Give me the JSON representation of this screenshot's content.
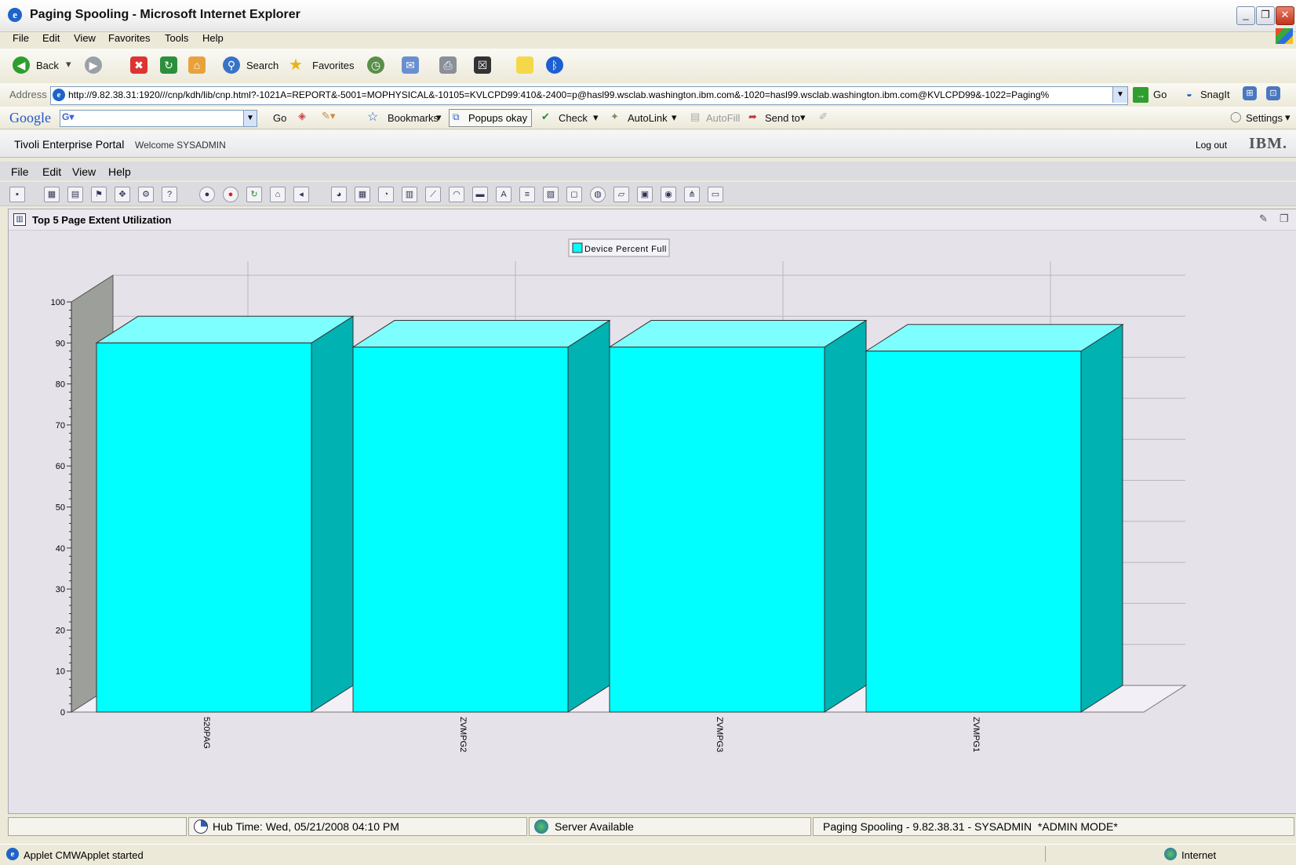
{
  "window": {
    "title": "Paging Spooling - Microsoft Internet Explorer"
  },
  "ie_menu": [
    "File",
    "Edit",
    "View",
    "Favorites",
    "Tools",
    "Help"
  ],
  "nav_toolbar": {
    "back": "Back",
    "search": "Search",
    "favorites": "Favorites"
  },
  "address_bar": {
    "label": "Address",
    "url": "http://9.82.38.31:1920///cnp/kdh/lib/cnp.html?-1021A=REPORT&-5001=MOPHYSICAL&-10105=KVLCPD99:410&-2400=p@hasl99.wsclab.washington.ibm.com&-1020=hasl99.wsclab.washington.ibm.com@KVLCPD99&-1022=Paging%",
    "go": "Go",
    "snagit": "SnagIt"
  },
  "google_bar": {
    "logo": "Google",
    "go": "Go",
    "bookmarks": "Bookmarks",
    "popups": "Popups okay",
    "check": "Check",
    "autolink": "AutoLink",
    "autofill": "AutoFill",
    "sendto": "Send to",
    "settings": "Settings"
  },
  "portal": {
    "name": "Tivoli Enterprise Portal",
    "welcome": "Welcome SYSADMIN",
    "logout": "Log out",
    "ibm": "IBM.",
    "menu": [
      "File",
      "Edit",
      "View",
      "Help"
    ]
  },
  "view": {
    "title": "Top 5 Page Extent Utilization"
  },
  "chart_data": {
    "type": "bar",
    "categories": [
      "520PAG",
      "ZVMPG2",
      "ZVMPG3",
      "ZVMPG1"
    ],
    "series": [
      {
        "name": "Device Percent Full",
        "values": [
          90,
          89,
          89,
          88
        ]
      }
    ],
    "ylim": [
      0,
      100
    ],
    "yticks": [
      0,
      10,
      20,
      30,
      40,
      50,
      60,
      70,
      80,
      90,
      100
    ],
    "legend": "top-center",
    "grid": true,
    "colors": {
      "bar_front": "#00ffff",
      "bar_top": "#7effff",
      "bar_side": "#00b2b2",
      "wall": "#9c9f9a"
    }
  },
  "status": {
    "hub_time": "Hub Time: Wed, 05/21/2008 04:10 PM",
    "server": "Server Available",
    "workspace": "Paging Spooling - 9.82.38.31 - SYSADMIN  *ADMIN MODE*"
  },
  "ie_status": {
    "text": "Applet CMWApplet started",
    "zone": "Internet"
  }
}
